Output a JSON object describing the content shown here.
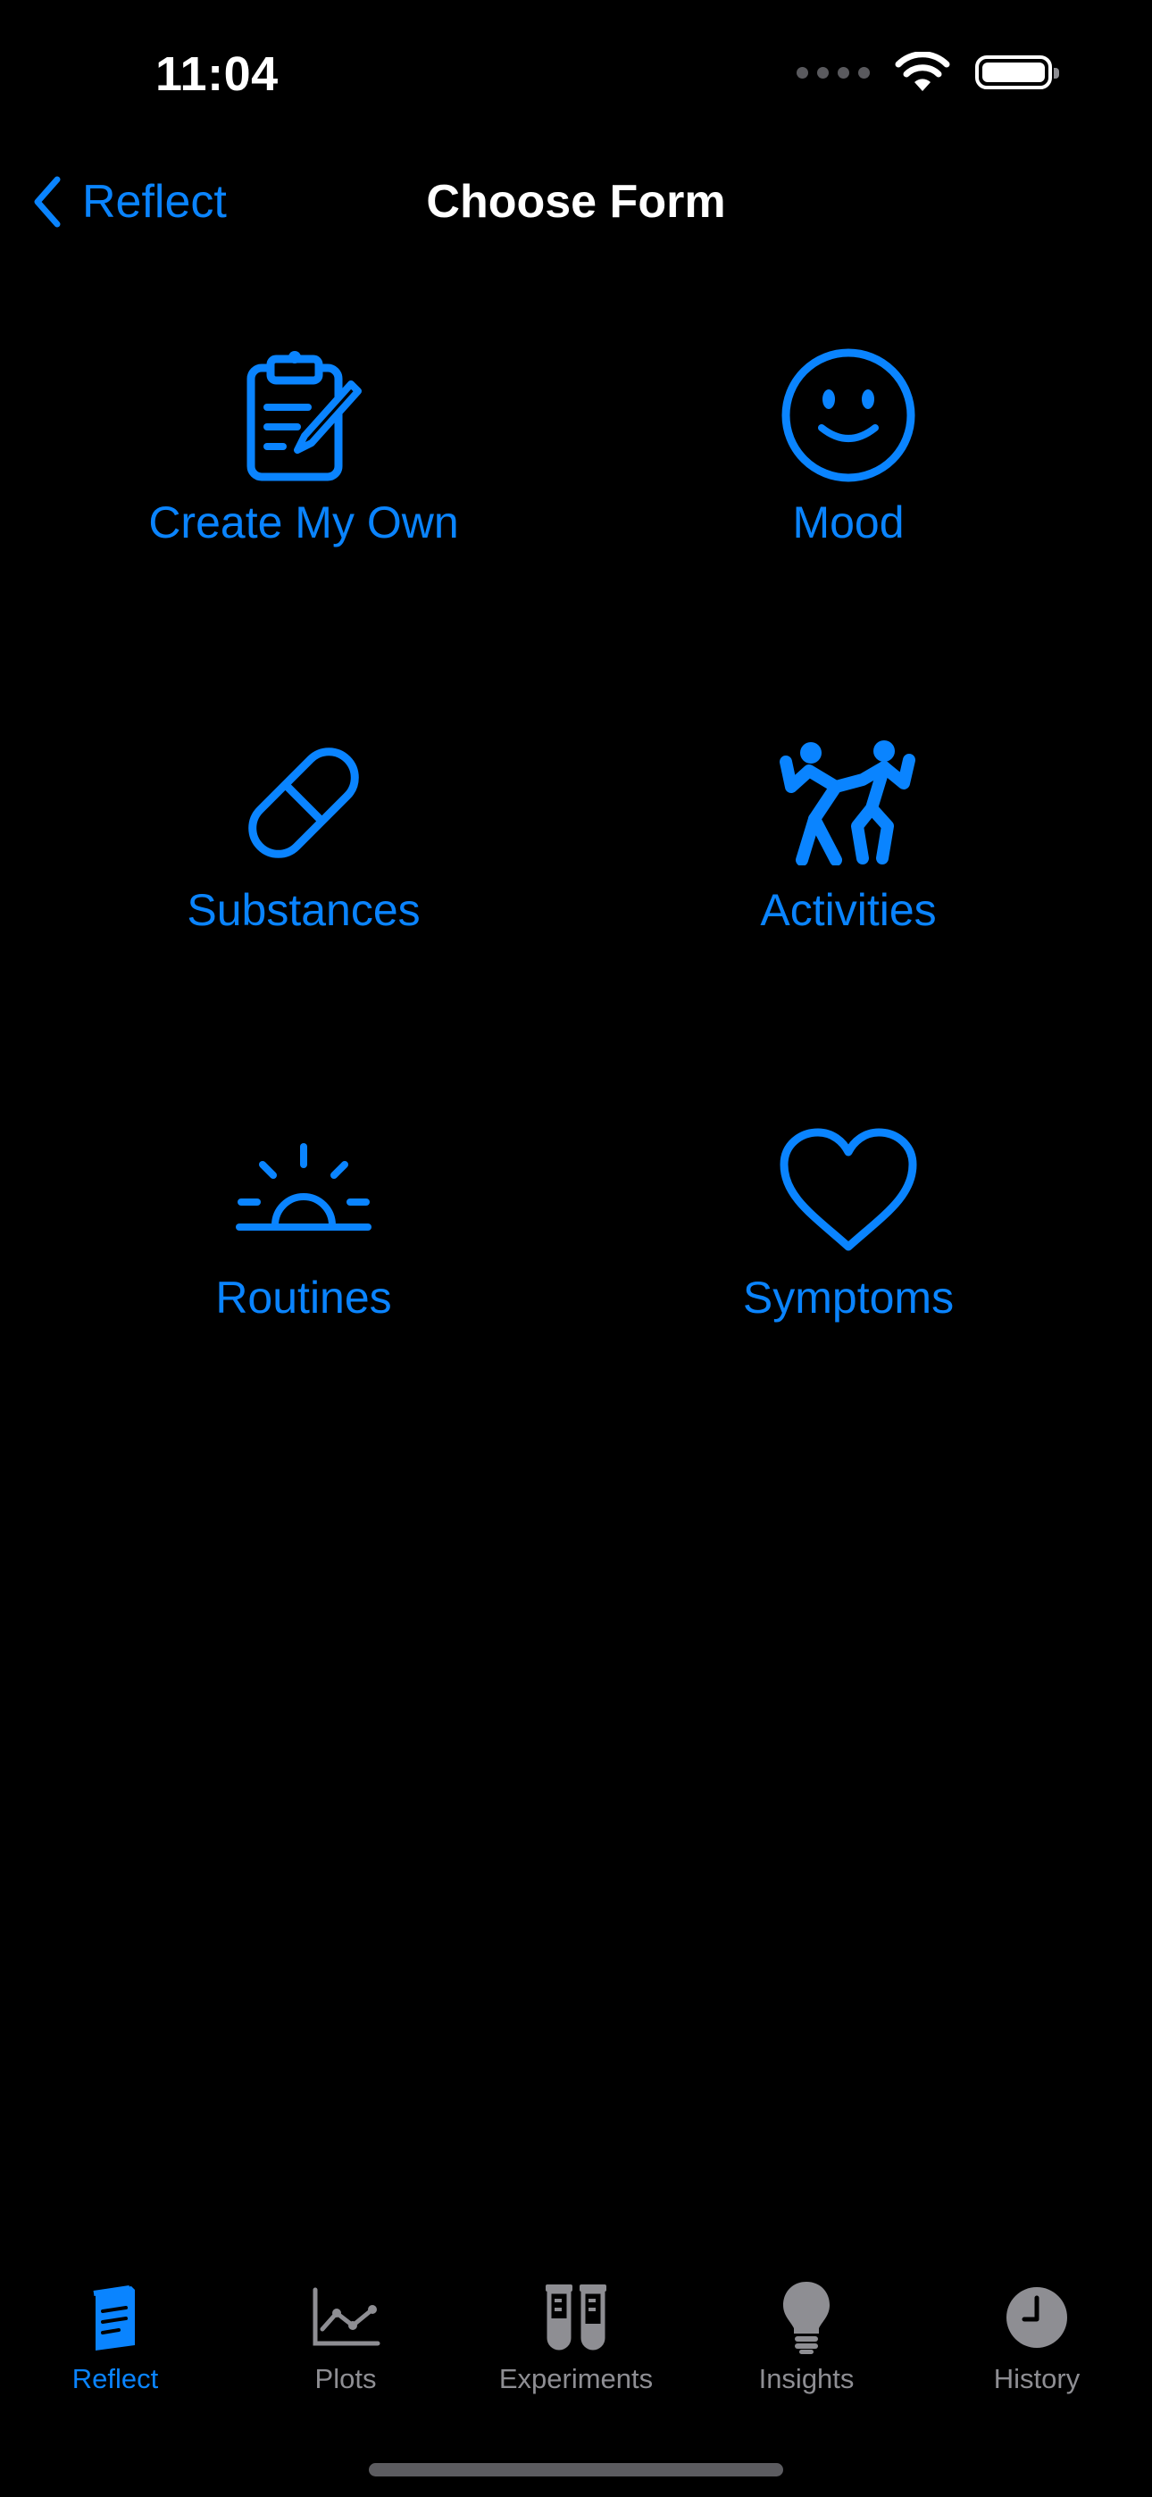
{
  "status_bar": {
    "time": "11:04"
  },
  "nav": {
    "back_label": "Reflect",
    "title": "Choose Form"
  },
  "forms": [
    {
      "label": "Create My Own",
      "icon": "clipboard-pencil-icon"
    },
    {
      "label": "Mood",
      "icon": "smiley-face-icon"
    },
    {
      "label": "Substances",
      "icon": "pill-icon"
    },
    {
      "label": "Activities",
      "icon": "dancing-figures-icon"
    },
    {
      "label": "Routines",
      "icon": "sunrise-icon"
    },
    {
      "label": "Symptoms",
      "icon": "heart-icon"
    }
  ],
  "tabs": [
    {
      "label": "Reflect",
      "icon": "note-icon",
      "active": true
    },
    {
      "label": "Plots",
      "icon": "line-chart-icon",
      "active": false
    },
    {
      "label": "Experiments",
      "icon": "test-tubes-icon",
      "active": false
    },
    {
      "label": "Insights",
      "icon": "lightbulb-icon",
      "active": false
    },
    {
      "label": "History",
      "icon": "clock-icon",
      "active": false
    }
  ],
  "colors": {
    "accent": "#0a84ff",
    "inactive": "#8e8e93",
    "background": "#000000"
  }
}
